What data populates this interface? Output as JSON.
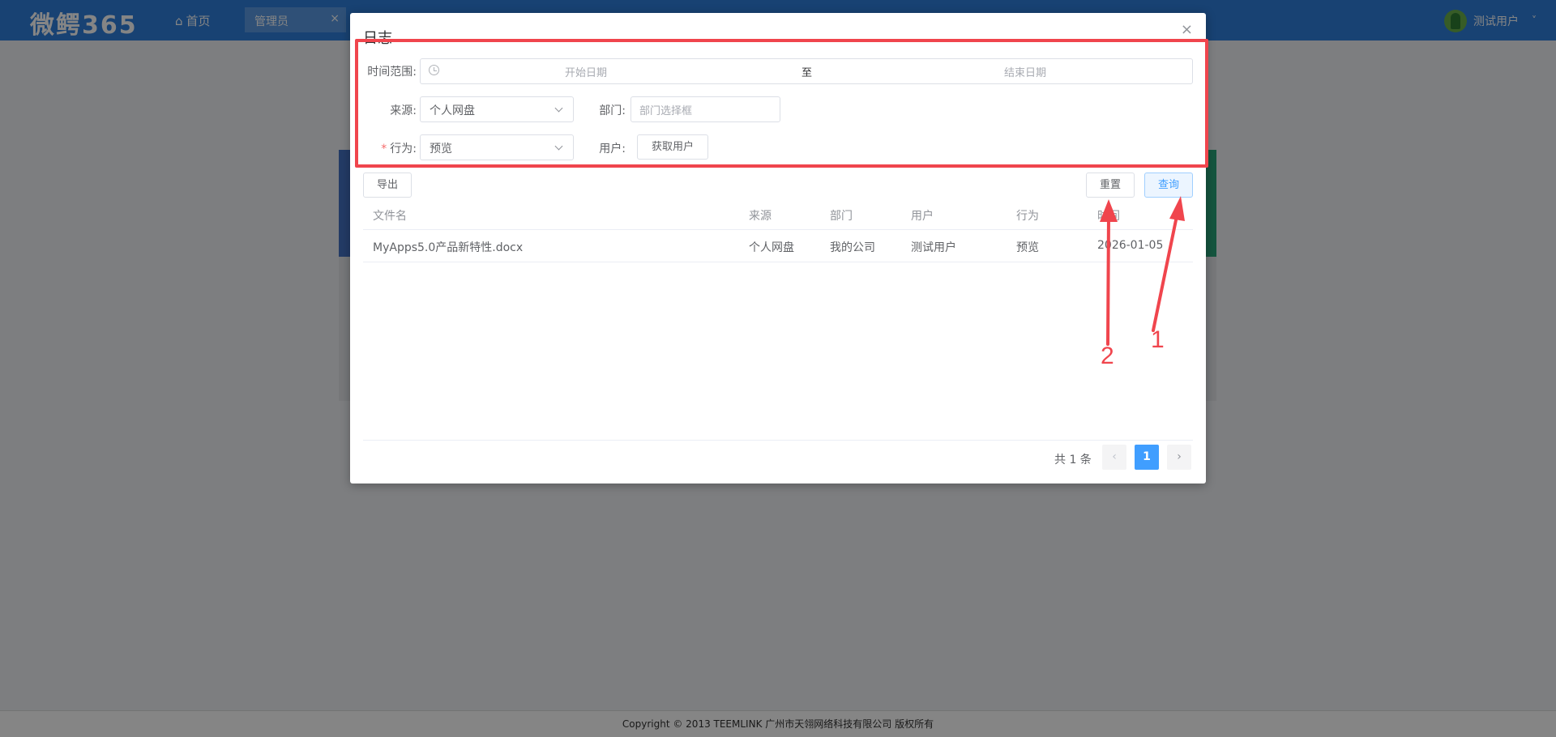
{
  "app": {
    "logo": "微鳄365",
    "nav_home": "首页",
    "nav_tab": "管理员",
    "nav_tab_close": "×",
    "user_name": "测试用户",
    "user_caret": "˅"
  },
  "footer": {
    "copyright": "Copyright © 2013 TEEMLINK 广州市天翎网络科技有限公司 版权所有"
  },
  "dialog": {
    "title": "日志",
    "close": "×",
    "form": {
      "time_range_label": "时间范围:",
      "range_start_placeholder": "开始日期",
      "range_separator": "至",
      "range_end_placeholder": "结束日期",
      "source_label": "来源:",
      "source_value": "个人网盘",
      "department_label": "部门:",
      "department_placeholder": "部门选择框",
      "action_required_mark": "*",
      "action_label": "行为:",
      "action_value": "预览",
      "user_label": "用户:",
      "fetch_user_button": "获取用户"
    },
    "toolbar": {
      "export_button": "导出",
      "reset_button": "重置",
      "query_button": "查询"
    },
    "table": {
      "columns": [
        "文件名",
        "来源",
        "部门",
        "用户",
        "行为",
        "时间"
      ],
      "rows": [
        [
          "MyApps5.0产品新特性.docx",
          "个人网盘",
          "我的公司",
          "测试用户",
          "预览",
          "2026-01-05"
        ]
      ]
    },
    "pagination": {
      "total": "共 1 条",
      "prev": "‹",
      "current": "1",
      "next": "›"
    }
  },
  "annotations": {
    "label_1": "1",
    "label_2": "2",
    "color": "#f0454d"
  }
}
